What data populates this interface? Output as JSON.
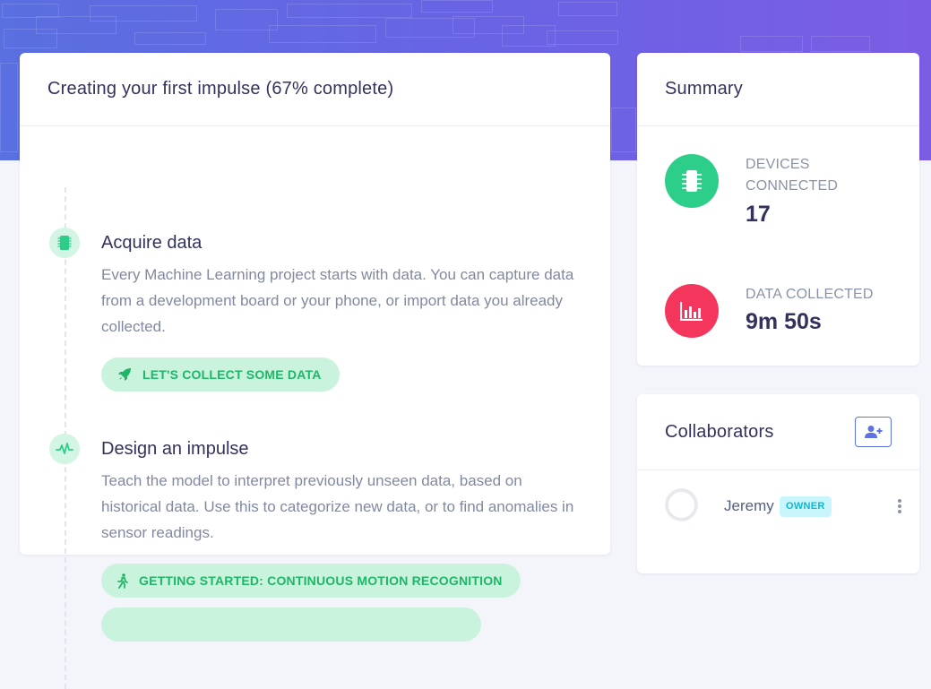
{
  "colors": {
    "accent": "#5e72e4",
    "success": "#2dce89",
    "success_light": "#c9f3dd",
    "danger": "#f5365c",
    "info_light": "#c9f5fc",
    "heading": "#32325d"
  },
  "main": {
    "title": "Creating your first impulse (67% complete)",
    "steps": [
      {
        "icon": "chip-icon",
        "title": "Acquire data",
        "description": "Every Machine Learning project starts with data. You can capture data from a development board or your phone, or import data you already collected.",
        "actions": [
          {
            "icon": "rocket-icon",
            "label": "LET'S COLLECT SOME DATA"
          }
        ]
      },
      {
        "icon": "pulse-icon",
        "title": "Design an impulse",
        "description": "Teach the model to interpret previously unseen data, based on historical data. Use this to categorize new data, or to find anomalies in sensor readings.",
        "actions": [
          {
            "icon": "walking-icon",
            "label": "GETTING STARTED: CONTINUOUS MOTION RECOGNITION"
          }
        ]
      }
    ]
  },
  "summary": {
    "title": "Summary",
    "stats": [
      {
        "icon": "chip-icon",
        "label": "DEVICES CONNECTED",
        "value": "17",
        "color": "#2dce89"
      },
      {
        "icon": "bar-chart-icon",
        "label": "DATA COLLECTED",
        "value": "9m 50s",
        "color": "#f5365c"
      }
    ]
  },
  "collaborators": {
    "title": "Collaborators",
    "add_icon": "add-user-icon",
    "list": [
      {
        "name": "Jeremy",
        "role": "OWNER"
      }
    ]
  }
}
